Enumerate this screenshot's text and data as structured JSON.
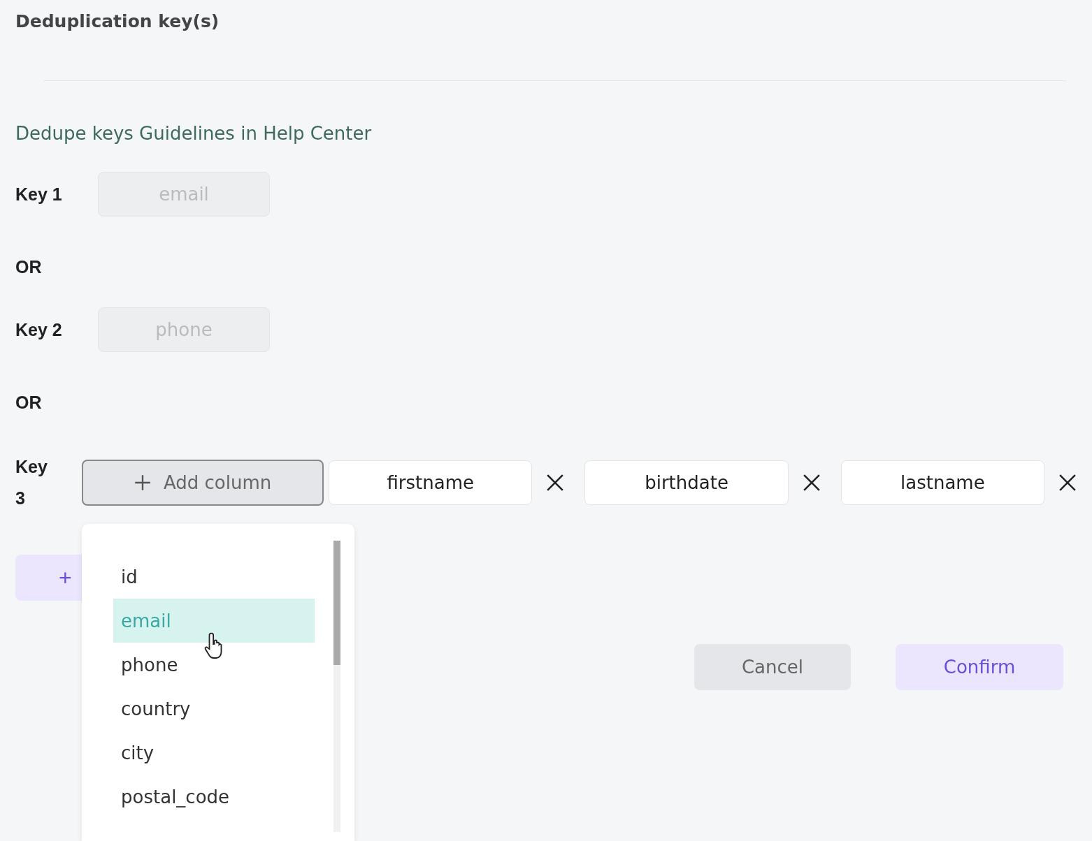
{
  "title": "Deduplication key(s)",
  "help_link": "Dedupe keys Guidelines in Help Center",
  "keys": [
    {
      "kind": "fixed",
      "label": "Key 1",
      "value": "email",
      "disabled": true
    },
    {
      "kind": "or",
      "label": "OR"
    },
    {
      "kind": "fixed",
      "label": "Key 2",
      "value": "phone",
      "disabled": true
    },
    {
      "kind": "or",
      "label": "OR"
    },
    {
      "kind": "columns",
      "label": "Key 3",
      "add_button": "Add column",
      "columns": [
        "firstname",
        "birthdate",
        "lastname"
      ],
      "dropdown": {
        "options": [
          {
            "label": "id",
            "selected": false
          },
          {
            "label": "email",
            "selected": true
          },
          {
            "label": "phone",
            "selected": false
          },
          {
            "label": "country",
            "selected": false
          },
          {
            "label": "city",
            "selected": false
          },
          {
            "label": "postal_code",
            "selected": false
          }
        ]
      }
    }
  ],
  "add_key_button": "+",
  "buttons": [
    {
      "kind": "secondary",
      "label": "Cancel"
    },
    {
      "kind": "primary",
      "label": "Confirm"
    }
  ]
}
